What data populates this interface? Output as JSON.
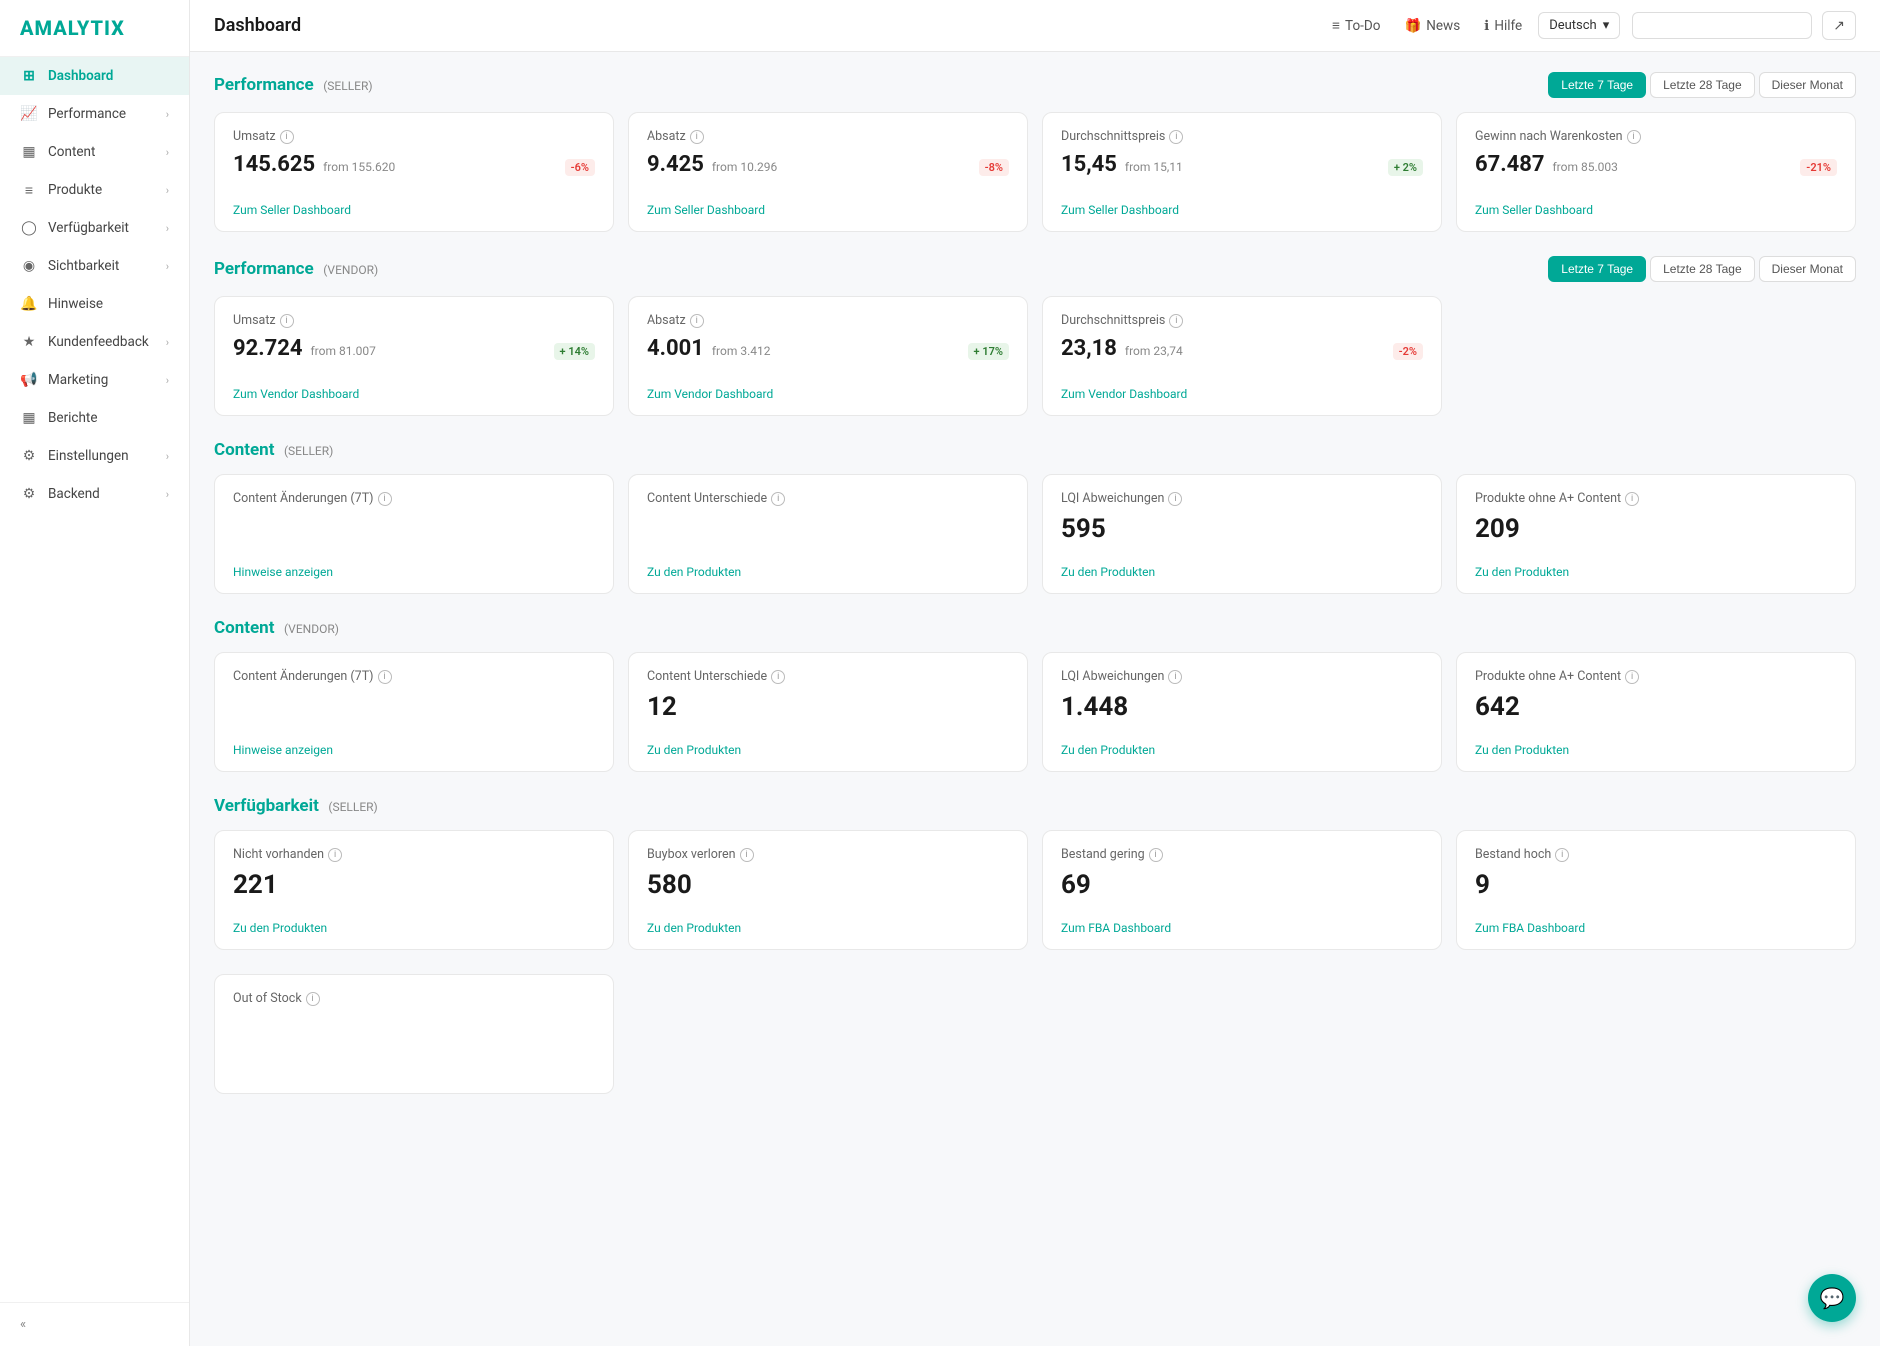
{
  "sidebar": {
    "logo": "AMALYTIX",
    "items": [
      {
        "id": "dashboard",
        "label": "Dashboard",
        "icon": "⊞",
        "active": true,
        "hasChevron": false
      },
      {
        "id": "performance",
        "label": "Performance",
        "icon": "📈",
        "active": false,
        "hasChevron": true
      },
      {
        "id": "content",
        "label": "Content",
        "icon": "▦",
        "active": false,
        "hasChevron": true
      },
      {
        "id": "produkte",
        "label": "Produkte",
        "icon": "≡",
        "active": false,
        "hasChevron": true
      },
      {
        "id": "verfugbarkeit",
        "label": "Verfügbarkeit",
        "icon": "◯",
        "active": false,
        "hasChevron": true
      },
      {
        "id": "sichtbarkeit",
        "label": "Sichtbarkeit",
        "icon": "◉",
        "active": false,
        "hasChevron": true
      },
      {
        "id": "hinweise",
        "label": "Hinweise",
        "icon": "🔔",
        "active": false,
        "hasChevron": false
      },
      {
        "id": "kundenfeedback",
        "label": "Kundenfeedback",
        "icon": "★",
        "active": false,
        "hasChevron": true
      },
      {
        "id": "marketing",
        "label": "Marketing",
        "icon": "📢",
        "active": false,
        "hasChevron": true
      },
      {
        "id": "berichte",
        "label": "Berichte",
        "icon": "▦",
        "active": false,
        "hasChevron": false
      },
      {
        "id": "einstellungen",
        "label": "Einstellungen",
        "icon": "⚙",
        "active": false,
        "hasChevron": true
      },
      {
        "id": "backend",
        "label": "Backend",
        "icon": "⚙",
        "active": false,
        "hasChevron": true
      }
    ],
    "collapse_label": "«"
  },
  "topbar": {
    "title": "Dashboard",
    "nav": [
      {
        "id": "todo",
        "icon": "≡",
        "label": "To-Do"
      },
      {
        "id": "news",
        "icon": "🎁",
        "label": "News"
      },
      {
        "id": "hilfe",
        "icon": "ℹ",
        "label": "Hilfe"
      }
    ],
    "language": "Deutsch",
    "search_placeholder": ""
  },
  "performance_seller": {
    "title": "Performance",
    "subtitle": "(SELLER)",
    "time_buttons": [
      "Letzte 7 Tage",
      "Letzte 28 Tage",
      "Dieser Monat"
    ],
    "active_time": 0,
    "cards": [
      {
        "label": "Umsatz",
        "value": "145.625",
        "from_label": "from 155.620",
        "badge": "-6%",
        "badge_type": "red",
        "link": "Zum Seller Dashboard"
      },
      {
        "label": "Absatz",
        "value": "9.425",
        "from_label": "from 10.296",
        "badge": "-8%",
        "badge_type": "red",
        "link": "Zum Seller Dashboard"
      },
      {
        "label": "Durchschnittspreis",
        "value": "15,45",
        "from_label": "from 15,11",
        "badge": "+ 2%",
        "badge_type": "green",
        "link": "Zum Seller Dashboard"
      },
      {
        "label": "Gewinn nach Warenkosten",
        "value": "67.487",
        "from_label": "from 85.003",
        "badge": "-21%",
        "badge_type": "red",
        "link": "Zum Seller Dashboard"
      }
    ]
  },
  "performance_vendor": {
    "title": "Performance",
    "subtitle": "(VENDOR)",
    "time_buttons": [
      "Letzte 7 Tage",
      "Letzte 28 Tage",
      "Dieser Monat"
    ],
    "active_time": 0,
    "cards": [
      {
        "label": "Umsatz",
        "value": "92.724",
        "from_label": "from 81.007",
        "badge": "+ 14%",
        "badge_type": "green",
        "link": "Zum Vendor Dashboard"
      },
      {
        "label": "Absatz",
        "value": "4.001",
        "from_label": "from 3.412",
        "badge": "+ 17%",
        "badge_type": "green",
        "link": "Zum Vendor Dashboard"
      },
      {
        "label": "Durchschnittspreis",
        "value": "23,18",
        "from_label": "from 23,74",
        "badge": "-2%",
        "badge_type": "red",
        "link": "Zum Vendor Dashboard"
      }
    ]
  },
  "content_seller": {
    "title": "Content",
    "subtitle": "(SELLER)",
    "cards": [
      {
        "label": "Content Änderungen (7T)",
        "value": null,
        "link": "Hinweise anzeigen"
      },
      {
        "label": "Content Unterschiede",
        "value": null,
        "link": "Zu den Produkten"
      },
      {
        "label": "LQI Abweichungen",
        "value": "595",
        "link": "Zu den Produkten"
      },
      {
        "label": "Produkte ohne A+ Content",
        "value": "209",
        "link": "Zu den Produkten"
      }
    ]
  },
  "content_vendor": {
    "title": "Content",
    "subtitle": "(VENDOR)",
    "cards": [
      {
        "label": "Content Änderungen (7T)",
        "value": null,
        "link": "Hinweise anzeigen"
      },
      {
        "label": "Content Unterschiede",
        "value": "12",
        "link": "Zu den Produkten"
      },
      {
        "label": "LQI Abweichungen",
        "value": "1.448",
        "link": "Zu den Produkten"
      },
      {
        "label": "Produkte ohne A+ Content",
        "value": "642",
        "link": "Zu den Produkten"
      }
    ]
  },
  "verfugbarkeit_seller": {
    "title": "Verfügbarkeit",
    "subtitle": "(SELLER)",
    "cards": [
      {
        "label": "Nicht vorhanden",
        "value": "221",
        "link": "Zu den Produkten"
      },
      {
        "label": "Buybox verloren",
        "value": "580",
        "link": "Zu den Produkten"
      },
      {
        "label": "Bestand gering",
        "value": "69",
        "link": "Zum FBA Dashboard"
      },
      {
        "label": "Bestand hoch",
        "value": "9",
        "link": "Zum FBA Dashboard"
      }
    ]
  },
  "out_of_stock": {
    "label": "Out of Stock"
  },
  "colors": {
    "primary": "#00a896",
    "red_badge": "#e53935",
    "green_badge": "#2e7d32"
  }
}
